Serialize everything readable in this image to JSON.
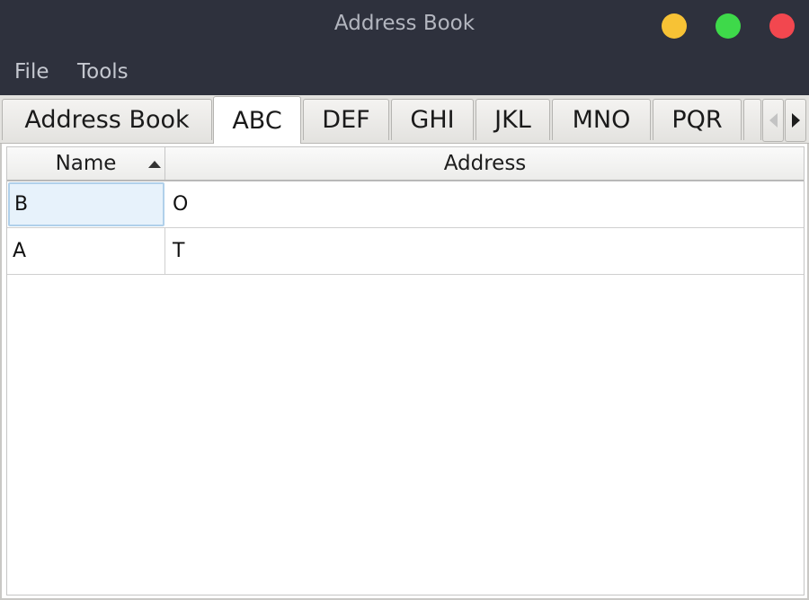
{
  "window": {
    "title": "Address Book",
    "controls": {
      "minimize_color": "#f7c235",
      "maximize_color": "#3ed94a",
      "close_color": "#f2474f"
    }
  },
  "menu": [
    "File",
    "Tools"
  ],
  "tabs": [
    {
      "label": "Address Book",
      "active": false
    },
    {
      "label": "ABC",
      "active": true
    },
    {
      "label": "DEF",
      "active": false
    },
    {
      "label": "GHI",
      "active": false
    },
    {
      "label": "JKL",
      "active": false
    },
    {
      "label": "MNO",
      "active": false
    },
    {
      "label": "PQR",
      "active": false
    }
  ],
  "table": {
    "columns": [
      "Name",
      "Address"
    ],
    "sort": {
      "column": "Name",
      "direction": "ascending"
    },
    "rows": [
      {
        "name": "B",
        "address": "O"
      },
      {
        "name": "A",
        "address": "T"
      }
    ]
  },
  "icons": {
    "tab_scroll_left": "chevron-left-icon",
    "tab_scroll_right": "chevron-right-icon",
    "sort": "sort-ascending-icon"
  }
}
